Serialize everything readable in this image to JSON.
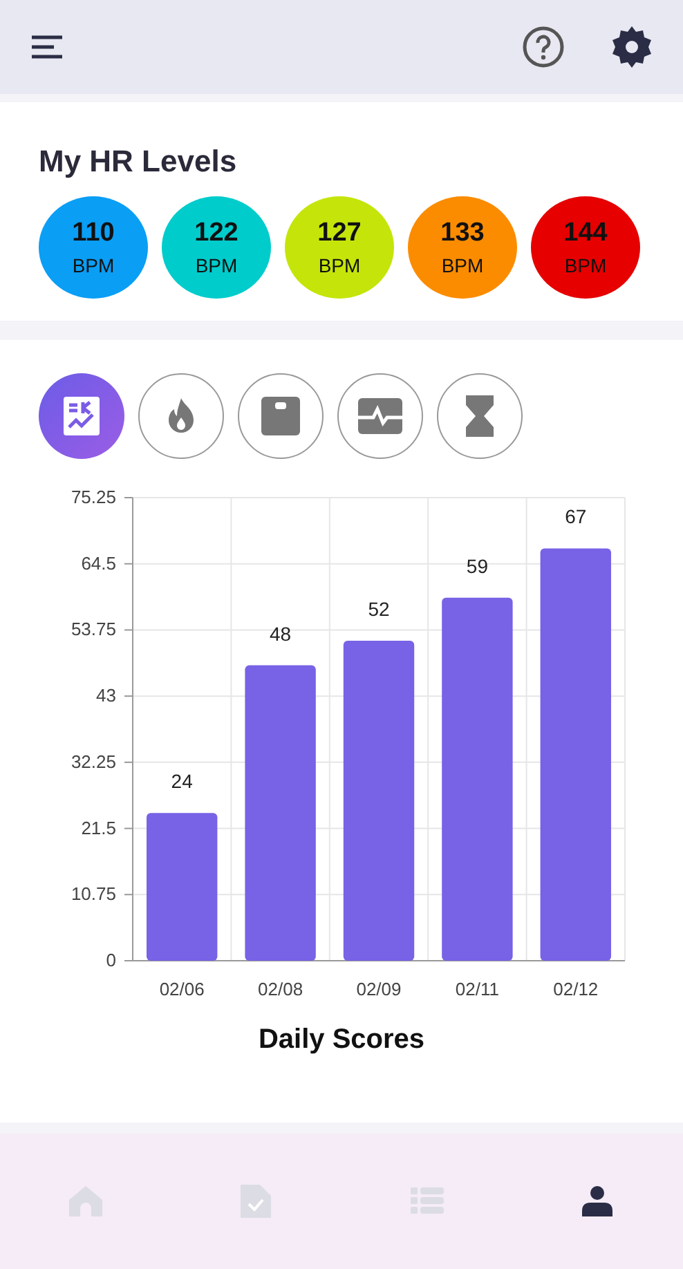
{
  "hr_levels": {
    "title": "My HR Levels",
    "levels": [
      {
        "value": "110",
        "unit": "BPM",
        "color": "#0a9ef5"
      },
      {
        "value": "122",
        "unit": "BPM",
        "color": "#00cccc"
      },
      {
        "value": "127",
        "unit": "BPM",
        "color": "#c5e50a"
      },
      {
        "value": "133",
        "unit": "BPM",
        "color": "#fb8c00"
      },
      {
        "value": "144",
        "unit": "BPM",
        "color": "#e60000"
      }
    ]
  },
  "metric_tabs": [
    {
      "kind": "score",
      "selected": true
    },
    {
      "kind": "calories",
      "selected": false
    },
    {
      "kind": "weight",
      "selected": false
    },
    {
      "kind": "heart",
      "selected": false
    },
    {
      "kind": "time",
      "selected": false
    }
  ],
  "chart": {
    "chart_data": {
      "type": "bar",
      "title": "Daily Scores",
      "categories": [
        "02/06",
        "02/08",
        "02/09",
        "02/11",
        "02/12"
      ],
      "series": [
        {
          "color": "#7862e6",
          "values": [
            24,
            48,
            52,
            59,
            67
          ]
        }
      ],
      "grid": true,
      "ylim": [
        0,
        75.25
      ],
      "yticks": [
        0,
        {
          "value": 10.75,
          "label": "10.75"
        },
        {
          "value": 21.5,
          "label": "21.5"
        },
        {
          "value": 32.25,
          "label": "32.25"
        },
        43,
        {
          "value": 53.75,
          "label": "53.75"
        },
        {
          "value": 64.5,
          "label": "64.5"
        },
        {
          "value": 75.25,
          "label": "75.25"
        }
      ],
      "data_labels": true
    }
  },
  "bottom_nav": [
    {
      "kind": "home",
      "selected": false
    },
    {
      "kind": "report",
      "selected": false
    },
    {
      "kind": "list",
      "selected": false
    },
    {
      "kind": "profile",
      "selected": true
    }
  ]
}
